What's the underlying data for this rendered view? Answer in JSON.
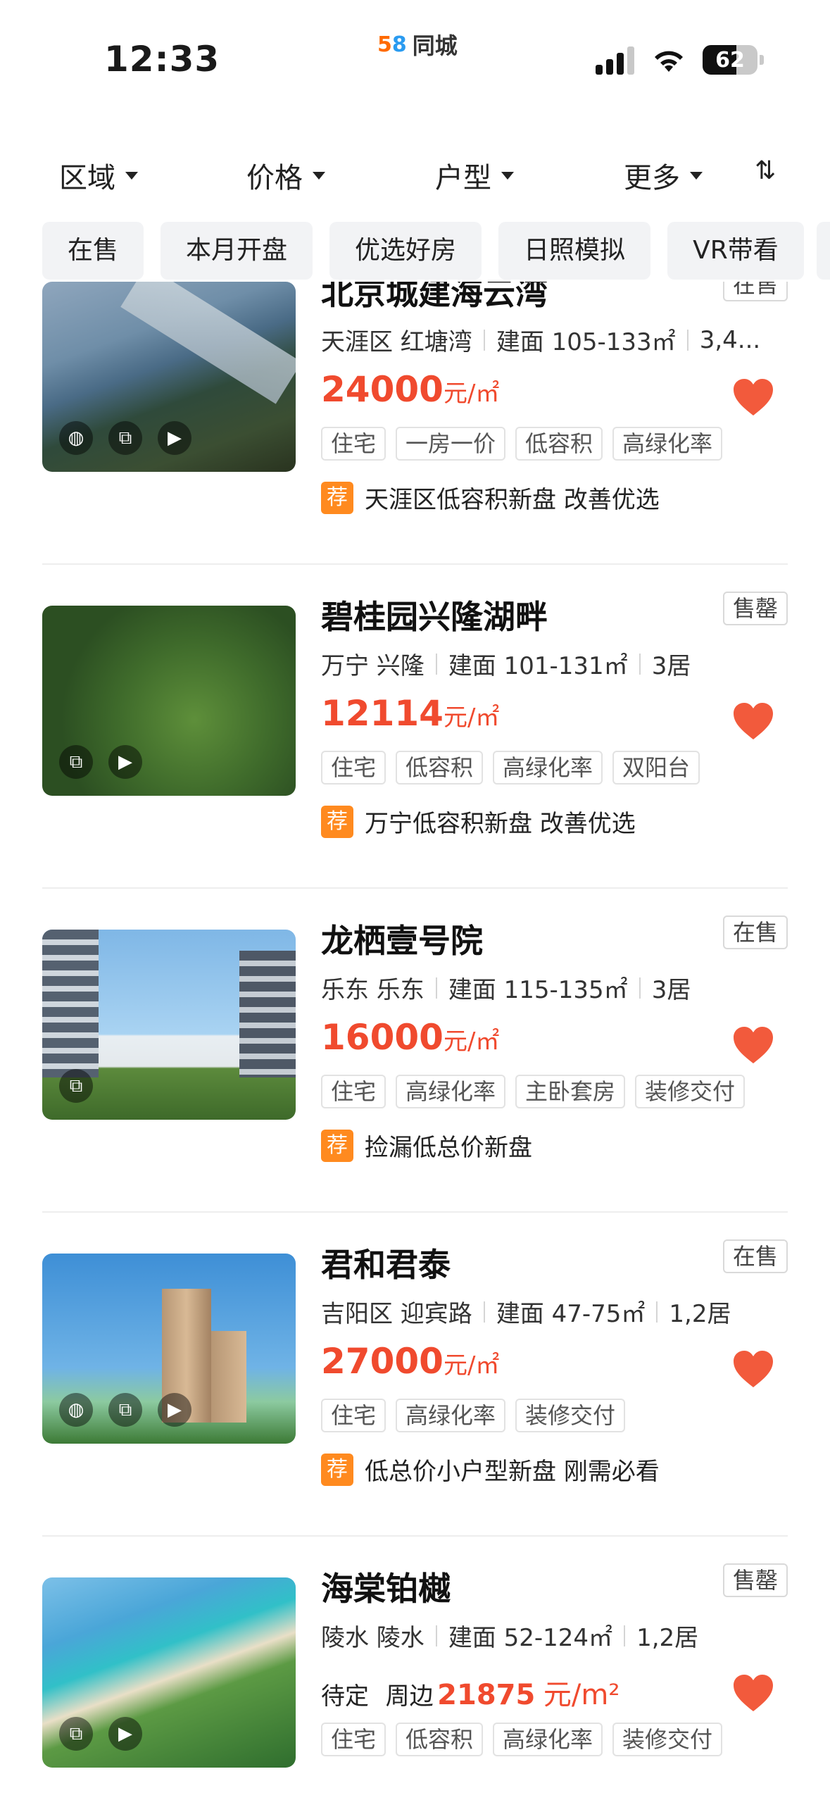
{
  "status_bar": {
    "time": "12:33",
    "app_logo_digit5": "5",
    "app_logo_digit8": "8",
    "app_name": "同城",
    "battery": "62",
    "battery_level_percent": 62
  },
  "filters": [
    {
      "label": "区域"
    },
    {
      "label": "价格"
    },
    {
      "label": "户型"
    },
    {
      "label": "更多"
    }
  ],
  "sort_icon": "sort-icon",
  "chips": [
    "在售",
    "本月开盘",
    "优选好房",
    "日照模拟",
    "VR带看"
  ],
  "price_unit": "元/㎡",
  "rec_badge": "荐",
  "listings": [
    {
      "title": "北京城建海云湾",
      "status": "在售",
      "district": "天涯区 红塘湾",
      "area": "建面 105-133㎡",
      "rooms": "3,4...",
      "price": "24000",
      "tags": [
        "住宅",
        "一房一价",
        "低容积",
        "高绿化率"
      ],
      "recommendation": "天涯区低容积新盘 改善优选"
    },
    {
      "title": "碧桂园兴隆湖畔",
      "status": "售罄",
      "district": "万宁 兴隆",
      "area": "建面 101-131㎡",
      "rooms": "3居",
      "price": "12114",
      "tags": [
        "住宅",
        "低容积",
        "高绿化率",
        "双阳台"
      ],
      "recommendation": "万宁低容积新盘 改善优选"
    },
    {
      "title": "龙栖壹号院",
      "status": "在售",
      "district": "乐东 乐东",
      "area": "建面 115-135㎡",
      "rooms": "3居",
      "price": "16000",
      "tags": [
        "住宅",
        "高绿化率",
        "主卧套房",
        "装修交付"
      ],
      "recommendation": "捡漏低总价新盘"
    },
    {
      "title": "君和君泰",
      "status": "在售",
      "district": "吉阳区 迎宾路",
      "area": "建面 47-75㎡",
      "rooms": "1,2居",
      "price": "27000",
      "tags": [
        "住宅",
        "高绿化率",
        "装修交付"
      ],
      "recommendation": "低总价小户型新盘 刚需必看"
    },
    {
      "title": "海棠铂樾",
      "status": "售罄",
      "district": "陵水 陵水",
      "area": "建面 52-124㎡",
      "rooms": "1,2居",
      "price_prefix": "待定",
      "price_middle": "周边",
      "price": "21875",
      "price_unit": "元/m²",
      "tags": [
        "住宅",
        "低容积",
        "高绿化率",
        "装修交付"
      ]
    }
  ],
  "colors": {
    "price_red": "#f04a2e",
    "heart_red": "#f25a3c",
    "rec_orange": "#ff8a1f",
    "chip_bg": "#f2f3f5"
  }
}
